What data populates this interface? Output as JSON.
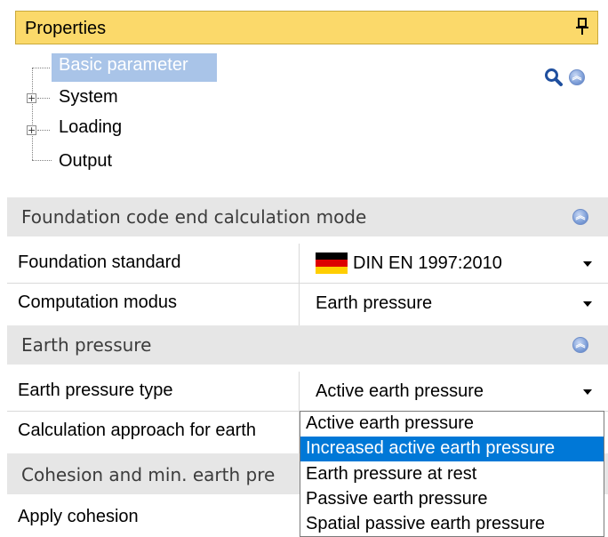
{
  "panel": {
    "title": "Properties",
    "pin_glyph": "📌"
  },
  "tree": {
    "nodes": [
      {
        "label": "Basic parameter",
        "expandable": false,
        "selected": true
      },
      {
        "label": "System",
        "expandable": true
      },
      {
        "label": "Loading",
        "expandable": true
      },
      {
        "label": "Output",
        "expandable": false
      }
    ],
    "expander_glyph": "+"
  },
  "sections": [
    {
      "title": "Foundation code end calculation mode"
    },
    {
      "title": "Earth pressure"
    },
    {
      "title": "Cohesion and min. earth pre"
    }
  ],
  "rows": {
    "foundation_standard": {
      "label": "Foundation standard",
      "value": "DIN EN 1997:2010"
    },
    "computation_modus": {
      "label": "Computation modus",
      "value": "Earth pressure"
    },
    "earth_pressure_type": {
      "label": "Earth pressure type",
      "value": "Active earth pressure"
    },
    "calculation_approach": {
      "label": "Calculation approach for earth"
    },
    "apply_cohesion": {
      "label": "Apply cohesion"
    }
  },
  "dropdown": {
    "options": [
      "Active earth pressure",
      "Increased active earth pressure",
      "Earth pressure at rest",
      "Passive earth pressure",
      "Spatial passive earth pressure"
    ],
    "highlighted_index": 1
  },
  "colors": {
    "title_bar": "#fbd96a",
    "selection": "#0078d7",
    "tree_selection": "#a9c4e8",
    "section_bg": "#e6e6e6",
    "flag": [
      "#000000",
      "#dd0000",
      "#ffce00"
    ]
  },
  "icons": [
    "pin-icon",
    "search-icon",
    "collapse-icon"
  ]
}
